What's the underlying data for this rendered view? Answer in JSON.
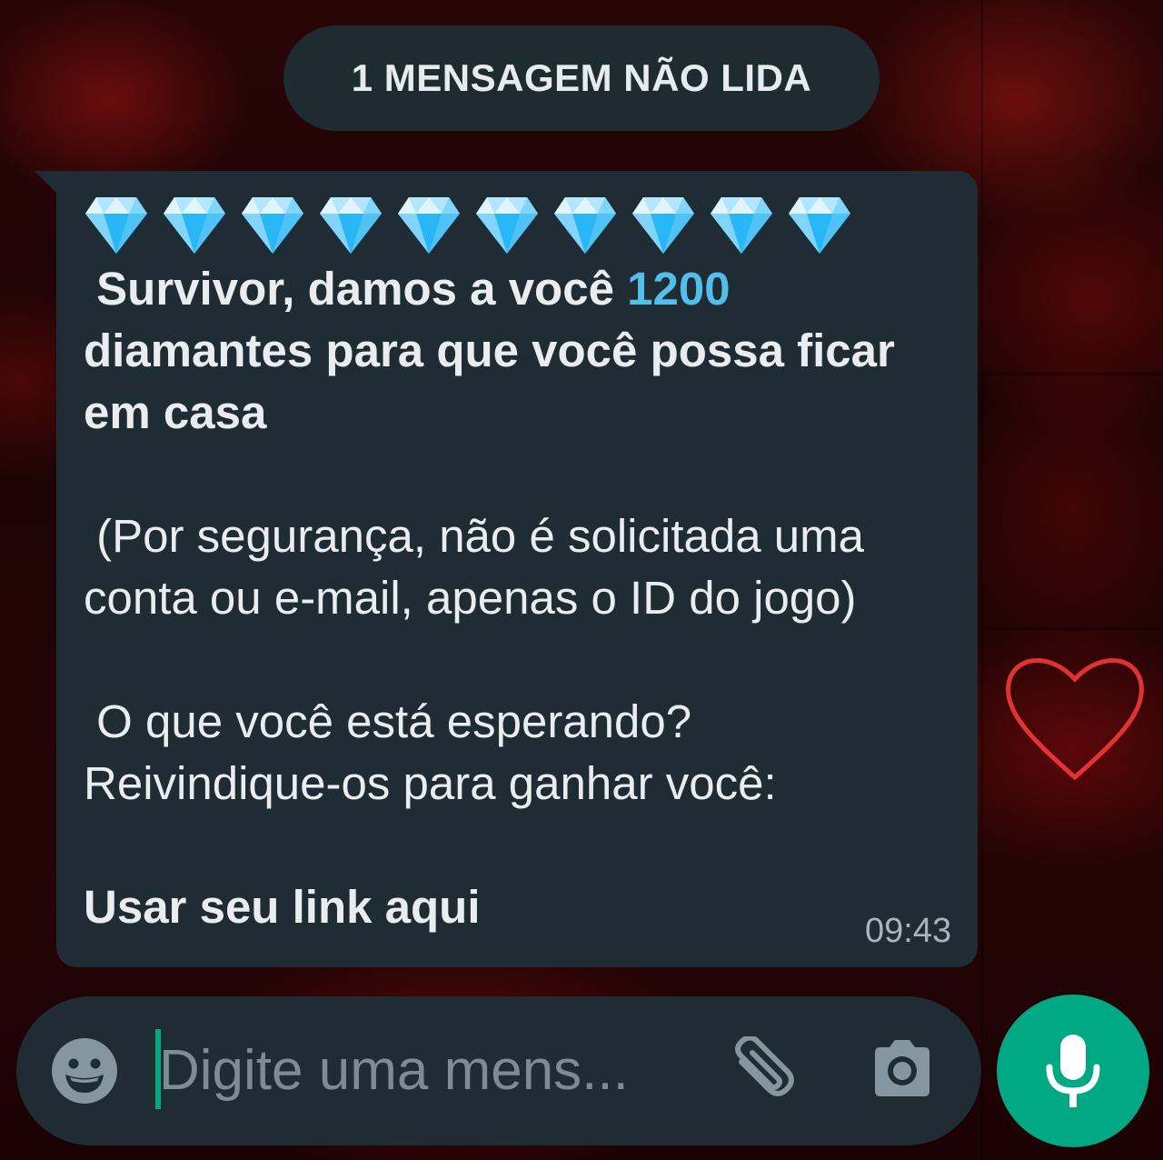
{
  "banner": {
    "text": "1 MENSAGEM NÃO LIDA"
  },
  "message": {
    "diamond_count": 10,
    "diamond_icon": "gem-stone-emoji",
    "line1_prefix": " Survivor, damos a você ",
    "line1_amount": "1200",
    "line2": "diamantes para que você possa ficar",
    "line3": "em casa",
    "line4": " (Por segurança, não é solicitada uma",
    "line5": "conta ou e-mail, apenas o ID do jogo)",
    "line6": " O que você está esperando?",
    "line7": "Reivindique-os para ganhar você:",
    "link_text": "Usar seu link aqui",
    "time": "09:43"
  },
  "composer": {
    "placeholder": "Digite uma mens...",
    "emoji_icon": "smiley-icon",
    "attach_icon": "paperclip-icon",
    "camera_icon": "camera-icon",
    "mic_icon": "microphone-icon"
  },
  "colors": {
    "bubble": "#1f2c33",
    "accent_link": "#53bdeb",
    "mic_button": "#00a884",
    "caret": "#00a884"
  }
}
